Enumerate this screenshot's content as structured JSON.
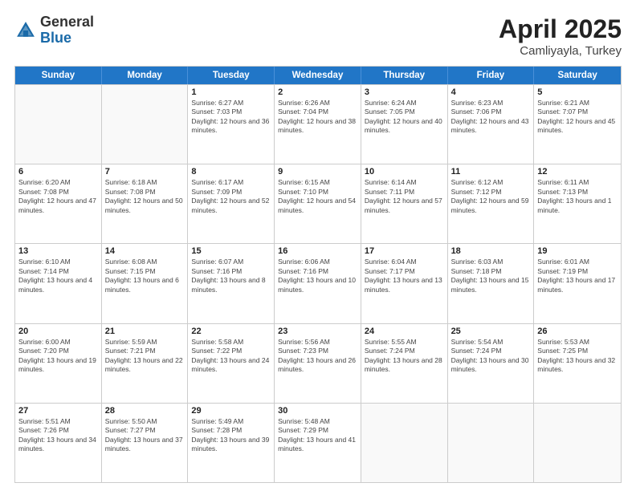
{
  "logo": {
    "general": "General",
    "blue": "Blue"
  },
  "title": {
    "month": "April 2025",
    "location": "Camliyayla, Turkey"
  },
  "weekdays": [
    "Sunday",
    "Monday",
    "Tuesday",
    "Wednesday",
    "Thursday",
    "Friday",
    "Saturday"
  ],
  "weeks": [
    [
      {
        "date": "",
        "sunrise": "",
        "sunset": "",
        "daylight": ""
      },
      {
        "date": "",
        "sunrise": "",
        "sunset": "",
        "daylight": ""
      },
      {
        "date": "1",
        "sunrise": "Sunrise: 6:27 AM",
        "sunset": "Sunset: 7:03 PM",
        "daylight": "Daylight: 12 hours and 36 minutes."
      },
      {
        "date": "2",
        "sunrise": "Sunrise: 6:26 AM",
        "sunset": "Sunset: 7:04 PM",
        "daylight": "Daylight: 12 hours and 38 minutes."
      },
      {
        "date": "3",
        "sunrise": "Sunrise: 6:24 AM",
        "sunset": "Sunset: 7:05 PM",
        "daylight": "Daylight: 12 hours and 40 minutes."
      },
      {
        "date": "4",
        "sunrise": "Sunrise: 6:23 AM",
        "sunset": "Sunset: 7:06 PM",
        "daylight": "Daylight: 12 hours and 43 minutes."
      },
      {
        "date": "5",
        "sunrise": "Sunrise: 6:21 AM",
        "sunset": "Sunset: 7:07 PM",
        "daylight": "Daylight: 12 hours and 45 minutes."
      }
    ],
    [
      {
        "date": "6",
        "sunrise": "Sunrise: 6:20 AM",
        "sunset": "Sunset: 7:08 PM",
        "daylight": "Daylight: 12 hours and 47 minutes."
      },
      {
        "date": "7",
        "sunrise": "Sunrise: 6:18 AM",
        "sunset": "Sunset: 7:08 PM",
        "daylight": "Daylight: 12 hours and 50 minutes."
      },
      {
        "date": "8",
        "sunrise": "Sunrise: 6:17 AM",
        "sunset": "Sunset: 7:09 PM",
        "daylight": "Daylight: 12 hours and 52 minutes."
      },
      {
        "date": "9",
        "sunrise": "Sunrise: 6:15 AM",
        "sunset": "Sunset: 7:10 PM",
        "daylight": "Daylight: 12 hours and 54 minutes."
      },
      {
        "date": "10",
        "sunrise": "Sunrise: 6:14 AM",
        "sunset": "Sunset: 7:11 PM",
        "daylight": "Daylight: 12 hours and 57 minutes."
      },
      {
        "date": "11",
        "sunrise": "Sunrise: 6:12 AM",
        "sunset": "Sunset: 7:12 PM",
        "daylight": "Daylight: 12 hours and 59 minutes."
      },
      {
        "date": "12",
        "sunrise": "Sunrise: 6:11 AM",
        "sunset": "Sunset: 7:13 PM",
        "daylight": "Daylight: 13 hours and 1 minute."
      }
    ],
    [
      {
        "date": "13",
        "sunrise": "Sunrise: 6:10 AM",
        "sunset": "Sunset: 7:14 PM",
        "daylight": "Daylight: 13 hours and 4 minutes."
      },
      {
        "date": "14",
        "sunrise": "Sunrise: 6:08 AM",
        "sunset": "Sunset: 7:15 PM",
        "daylight": "Daylight: 13 hours and 6 minutes."
      },
      {
        "date": "15",
        "sunrise": "Sunrise: 6:07 AM",
        "sunset": "Sunset: 7:16 PM",
        "daylight": "Daylight: 13 hours and 8 minutes."
      },
      {
        "date": "16",
        "sunrise": "Sunrise: 6:06 AM",
        "sunset": "Sunset: 7:16 PM",
        "daylight": "Daylight: 13 hours and 10 minutes."
      },
      {
        "date": "17",
        "sunrise": "Sunrise: 6:04 AM",
        "sunset": "Sunset: 7:17 PM",
        "daylight": "Daylight: 13 hours and 13 minutes."
      },
      {
        "date": "18",
        "sunrise": "Sunrise: 6:03 AM",
        "sunset": "Sunset: 7:18 PM",
        "daylight": "Daylight: 13 hours and 15 minutes."
      },
      {
        "date": "19",
        "sunrise": "Sunrise: 6:01 AM",
        "sunset": "Sunset: 7:19 PM",
        "daylight": "Daylight: 13 hours and 17 minutes."
      }
    ],
    [
      {
        "date": "20",
        "sunrise": "Sunrise: 6:00 AM",
        "sunset": "Sunset: 7:20 PM",
        "daylight": "Daylight: 13 hours and 19 minutes."
      },
      {
        "date": "21",
        "sunrise": "Sunrise: 5:59 AM",
        "sunset": "Sunset: 7:21 PM",
        "daylight": "Daylight: 13 hours and 22 minutes."
      },
      {
        "date": "22",
        "sunrise": "Sunrise: 5:58 AM",
        "sunset": "Sunset: 7:22 PM",
        "daylight": "Daylight: 13 hours and 24 minutes."
      },
      {
        "date": "23",
        "sunrise": "Sunrise: 5:56 AM",
        "sunset": "Sunset: 7:23 PM",
        "daylight": "Daylight: 13 hours and 26 minutes."
      },
      {
        "date": "24",
        "sunrise": "Sunrise: 5:55 AM",
        "sunset": "Sunset: 7:24 PM",
        "daylight": "Daylight: 13 hours and 28 minutes."
      },
      {
        "date": "25",
        "sunrise": "Sunrise: 5:54 AM",
        "sunset": "Sunset: 7:24 PM",
        "daylight": "Daylight: 13 hours and 30 minutes."
      },
      {
        "date": "26",
        "sunrise": "Sunrise: 5:53 AM",
        "sunset": "Sunset: 7:25 PM",
        "daylight": "Daylight: 13 hours and 32 minutes."
      }
    ],
    [
      {
        "date": "27",
        "sunrise": "Sunrise: 5:51 AM",
        "sunset": "Sunset: 7:26 PM",
        "daylight": "Daylight: 13 hours and 34 minutes."
      },
      {
        "date": "28",
        "sunrise": "Sunrise: 5:50 AM",
        "sunset": "Sunset: 7:27 PM",
        "daylight": "Daylight: 13 hours and 37 minutes."
      },
      {
        "date": "29",
        "sunrise": "Sunrise: 5:49 AM",
        "sunset": "Sunset: 7:28 PM",
        "daylight": "Daylight: 13 hours and 39 minutes."
      },
      {
        "date": "30",
        "sunrise": "Sunrise: 5:48 AM",
        "sunset": "Sunset: 7:29 PM",
        "daylight": "Daylight: 13 hours and 41 minutes."
      },
      {
        "date": "",
        "sunrise": "",
        "sunset": "",
        "daylight": ""
      },
      {
        "date": "",
        "sunrise": "",
        "sunset": "",
        "daylight": ""
      },
      {
        "date": "",
        "sunrise": "",
        "sunset": "",
        "daylight": ""
      }
    ]
  ]
}
